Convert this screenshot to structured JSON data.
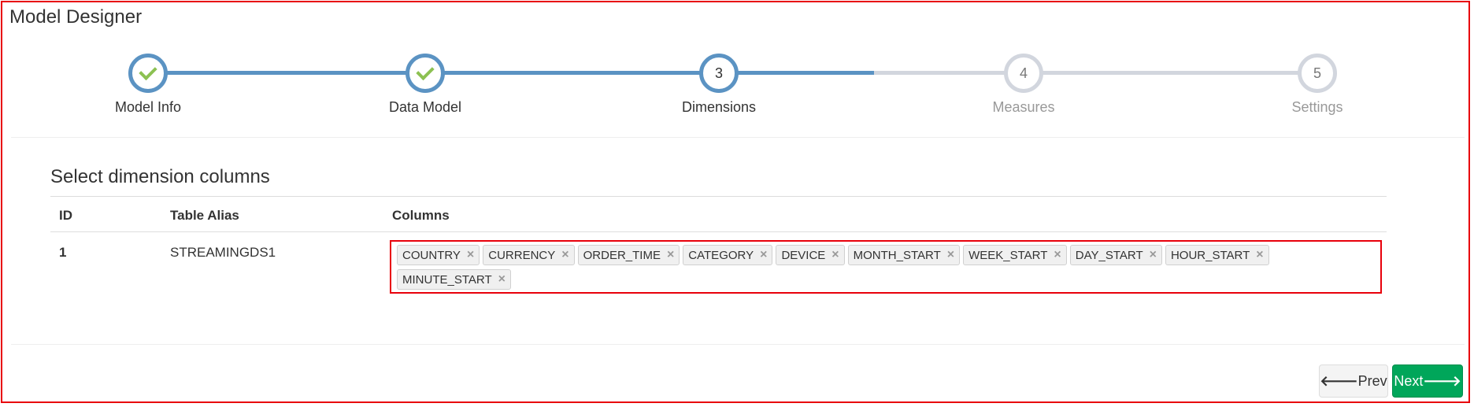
{
  "header": {
    "title": "Model Designer"
  },
  "stepper": {
    "steps": [
      {
        "number": "1",
        "label": "Model Info",
        "state": "done"
      },
      {
        "number": "2",
        "label": "Data Model",
        "state": "done"
      },
      {
        "number": "3",
        "label": "Dimensions",
        "state": "active"
      },
      {
        "number": "4",
        "label": "Measures",
        "state": "todo"
      },
      {
        "number": "5",
        "label": "Settings",
        "state": "todo"
      }
    ]
  },
  "section": {
    "title": "Select dimension columns"
  },
  "table": {
    "headers": {
      "id": "ID",
      "alias": "Table Alias",
      "columns": "Columns"
    },
    "rows": [
      {
        "id": "1",
        "alias": "STREAMINGDS1",
        "columns": [
          "COUNTRY",
          "CURRENCY",
          "ORDER_TIME",
          "CATEGORY",
          "DEVICE",
          "MONTH_START",
          "WEEK_START",
          "DAY_START",
          "HOUR_START",
          "MINUTE_START"
        ]
      }
    ]
  },
  "tag_remove_glyph": "×",
  "footer": {
    "prev_label": "Prev",
    "next_label": "Next",
    "prev_icon": "arrow-left-icon",
    "next_icon": "arrow-right-icon"
  },
  "colors": {
    "accent": "#5b93c3",
    "check": "#8cc152",
    "next_button": "#00a65a",
    "highlight_border": "#e8000b"
  }
}
